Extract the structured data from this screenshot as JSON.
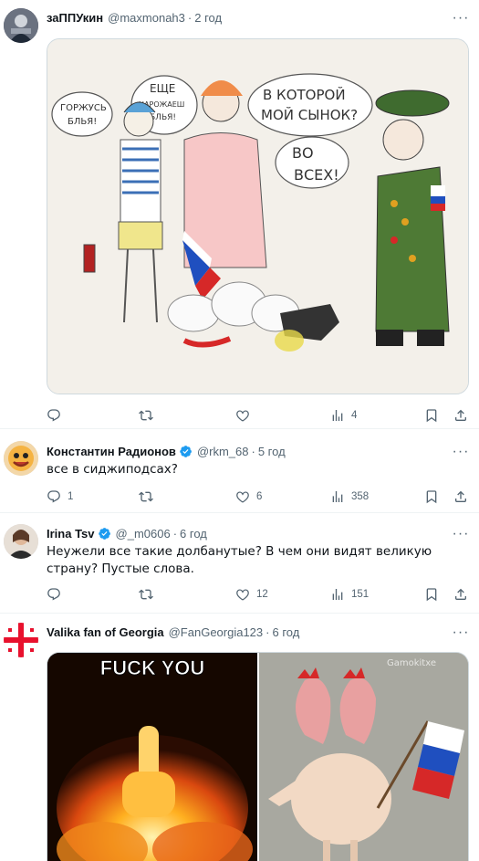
{
  "tweets": [
    {
      "name": "заППУкин",
      "handle": "@maxmonah3",
      "time": "2 год",
      "verified": false,
      "text": "",
      "replies": "",
      "retweets": "",
      "likes": "",
      "views": "4",
      "cartoon_labels": {
        "bubble1": [
          "ГОРЖУСЬ",
          "БЛЬЯ!"
        ],
        "bubble2": [
          "ЕЩЕ",
          "НАРОЖАЕШ",
          "БЛЬЯ!"
        ],
        "bubble3": [
          "В КОТОРОЙ",
          "МОЙ СЫНОК?"
        ],
        "bubble4": [
          "ВО",
          "ВСЕХ!"
        ]
      }
    },
    {
      "name": "Константин Радионов",
      "handle": "@rkm_68",
      "time": "5 год",
      "verified": true,
      "text": "все в сиджиподсах?",
      "replies": "1",
      "retweets": "",
      "likes": "6",
      "views": "358"
    },
    {
      "name": "Irina Tsv",
      "handle": "@_m0606",
      "time": "6 год",
      "verified": true,
      "text": "Неужели все такие долбанутые? В чем они видят великую страну? Пустые слова.",
      "replies": "",
      "retweets": "",
      "likes": "12",
      "views": "151"
    },
    {
      "name": "Valika fan of Georgia",
      "handle": "@FanGeorgia123",
      "time": "6 год",
      "verified": false,
      "text": "",
      "image_caption": "FUCK YOU",
      "watermark": "Gamokitxe"
    }
  ],
  "colors": {
    "verified": "#1d9bf0",
    "secondary": "#536471",
    "border": "#cfd9de"
  },
  "icons": [
    "reply-icon",
    "retweet-icon",
    "like-icon",
    "views-icon",
    "bookmark-icon",
    "share-icon",
    "more-icon",
    "verified-badge-icon"
  ]
}
